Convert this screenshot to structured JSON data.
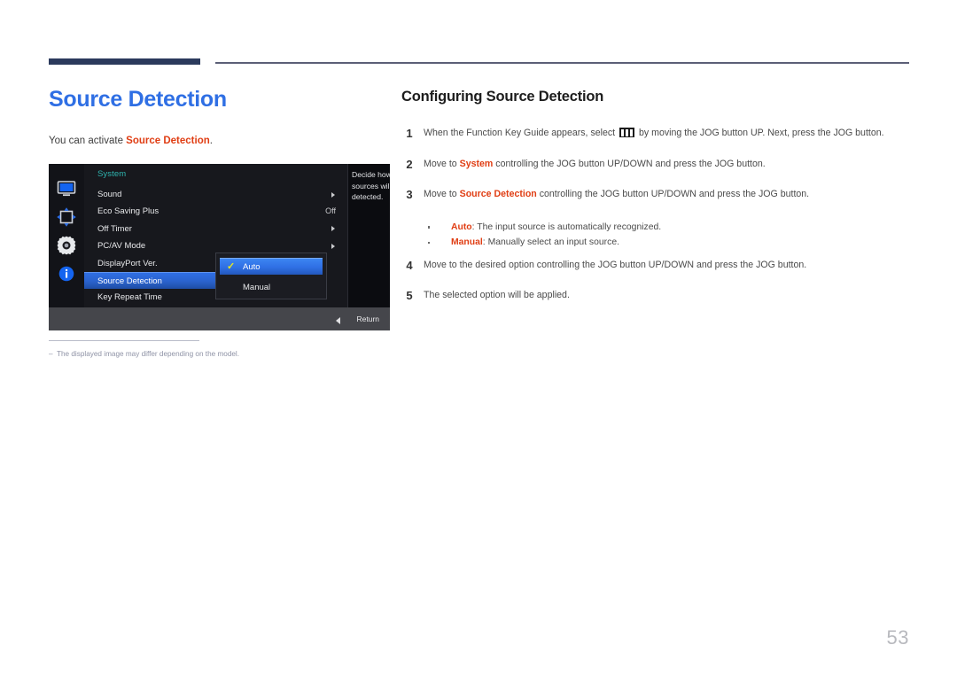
{
  "page": {
    "number": "53"
  },
  "left": {
    "title": "Source Detection",
    "lede_prefix": "You can activate ",
    "lede_highlight": "Source Detection",
    "lede_suffix": ".",
    "note": "The displayed image may differ depending on the model."
  },
  "osd": {
    "icons": [
      {
        "name": "display-icon",
        "label": "Picture"
      },
      {
        "name": "screen-adjust-icon",
        "label": "Screen Adjustment"
      },
      {
        "name": "system-gear-icon",
        "label": "System"
      },
      {
        "name": "information-icon",
        "label": "Information"
      }
    ],
    "section_title": "System",
    "rows": [
      {
        "label": "Sound",
        "value": "",
        "caret": true,
        "selected": false
      },
      {
        "label": "Eco Saving Plus",
        "value": "Off",
        "caret": false,
        "selected": false
      },
      {
        "label": "Off Timer",
        "value": "",
        "caret": true,
        "selected": false
      },
      {
        "label": "PC/AV Mode",
        "value": "",
        "caret": true,
        "selected": false
      },
      {
        "label": "DisplayPort Ver.",
        "value": "",
        "caret": false,
        "selected": false
      },
      {
        "label": "Source Detection",
        "value": "",
        "caret": false,
        "selected": true
      },
      {
        "label": "Key Repeat Time",
        "value": "",
        "caret": false,
        "selected": false
      }
    ],
    "submenu": {
      "options": [
        {
          "label": "Auto",
          "checked": true,
          "active": true
        },
        {
          "label": "Manual",
          "checked": false,
          "active": false
        }
      ],
      "check_glyph": "✓"
    },
    "description": "Decide how input sources will be detected.",
    "bottom": {
      "return_label": "Return"
    },
    "colors": {
      "highlight_blue": "#2f6fe4",
      "section_teal": "#2eb5b0",
      "check_yellow": "#e8e81f",
      "panel_dark": "#17181d"
    }
  },
  "right": {
    "heading": "Configuring Source Detection",
    "steps": [
      {
        "num": "1",
        "parts": [
          {
            "type": "text",
            "value": "When the Function Key Guide appears, select "
          },
          {
            "type": "icon",
            "value": "function-key-guide-icon"
          },
          {
            "type": "text",
            "value": " by moving the JOG button UP. Next, press the JOG button."
          }
        ]
      },
      {
        "num": "2",
        "parts": [
          {
            "type": "text",
            "value": "Move to "
          },
          {
            "type": "hl",
            "value": "System"
          },
          {
            "type": "text",
            "value": " controlling the JOG button UP/DOWN and press the JOG button."
          }
        ]
      },
      {
        "num": "3",
        "parts": [
          {
            "type": "text",
            "value": "Move to "
          },
          {
            "type": "hl",
            "value": "Source Detection"
          },
          {
            "type": "text",
            "value": " controlling the JOG button UP/DOWN and press the JOG button."
          }
        ]
      }
    ],
    "bullets": [
      {
        "hl": "Auto",
        "text": ": The input source is automatically recognized."
      },
      {
        "hl": "Manual",
        "text": ": Manually select an input source."
      }
    ],
    "steps_after": [
      {
        "num": "4",
        "parts": [
          {
            "type": "text",
            "value": "Move to the desired option controlling the JOG button UP/DOWN and press the JOG button."
          }
        ]
      },
      {
        "num": "5",
        "parts": [
          {
            "type": "text",
            "value": "The selected option will be applied."
          }
        ]
      }
    ]
  },
  "theme": {
    "title_blue": "#2f6fe4",
    "accent_red": "#e03e14",
    "rule_navy": "#2b3a5c"
  }
}
